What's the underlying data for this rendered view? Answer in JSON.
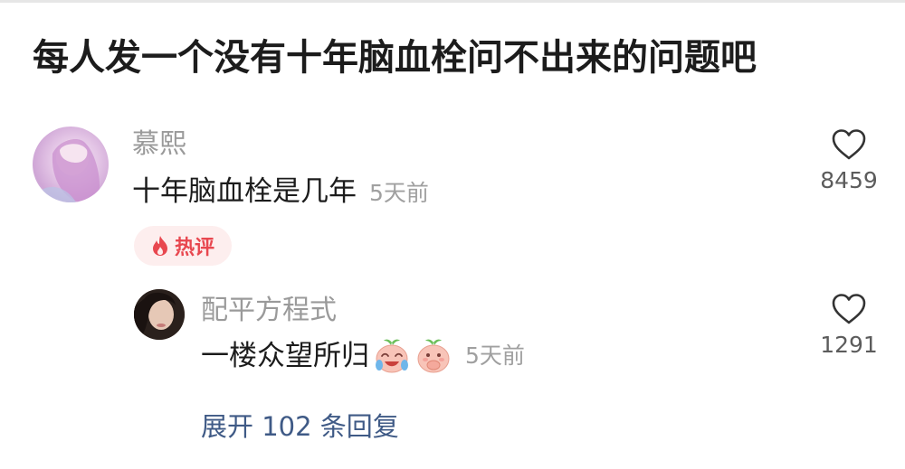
{
  "post": {
    "title": "每人发一个没有十年脑血栓问不出来的问题吧"
  },
  "comment": {
    "username": "慕熙",
    "text": "十年脑血栓是几年",
    "time": "5天前",
    "badge": "热评",
    "likes": "8459"
  },
  "reply": {
    "username": "配平方程式",
    "text": "一楼众望所归",
    "emojis": [
      "laughing-crying-peach-emoji",
      "covering-mouth-peach-emoji"
    ],
    "time": "5天前",
    "likes": "1291"
  },
  "expand": {
    "label": "展开 102 条回复"
  },
  "colors": {
    "badge_text": "#e8474f",
    "badge_bg": "#fdeeee",
    "link": "#3f5a86",
    "muted": "#9a9a9a"
  }
}
